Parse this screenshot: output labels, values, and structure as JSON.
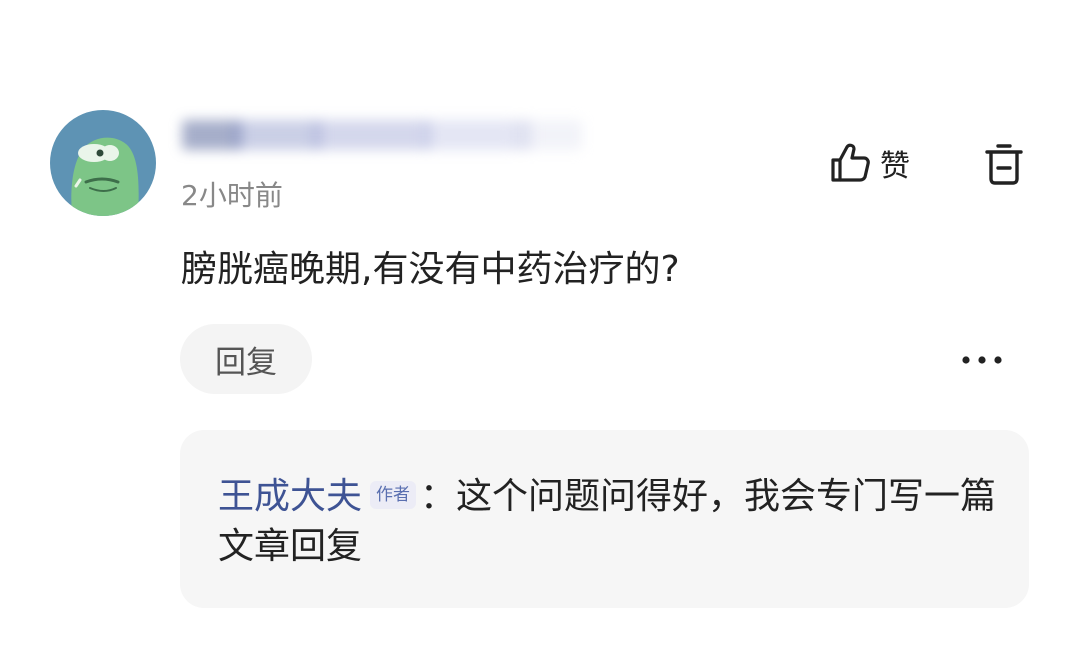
{
  "comment": {
    "avatar_icon": "green-cartoon-avatar",
    "username": "██████████",
    "time": "2小时前",
    "text": "膀胱癌晚期,有没有中药治疗的?",
    "like_label": "赞",
    "reply_label": "回复",
    "like_icon": "thumbs-up-icon",
    "delete_icon": "trash-icon",
    "more_icon": "more-dots-icon"
  },
  "reply": {
    "author": "王成大夫",
    "badge": "作者",
    "separator": "：",
    "text": "这个问题问得好，我会专门写一篇文章回复"
  },
  "colors": {
    "author_name": "#3e5394",
    "avatar_bg": "#5e93b4",
    "avatar_face": "#7dc587",
    "reply_bg": "#f6f6f6",
    "reply_button_bg": "#f4f4f4"
  }
}
